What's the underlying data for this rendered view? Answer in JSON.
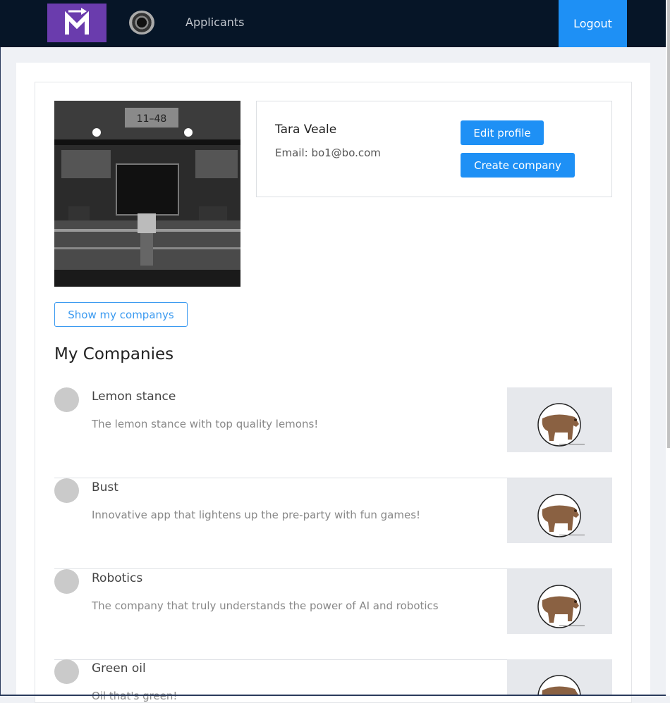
{
  "navbar": {
    "brand_letter": "M",
    "applicants_label": "Applicants",
    "logout_label": "Logout"
  },
  "profile": {
    "name": "Tara Veale",
    "email": "Email: bo1@bo.com",
    "photo_sign": "11–48",
    "edit_label": "Edit profile",
    "create_company_label": "Create company",
    "show_companies_label": "Show my companys"
  },
  "companies_section": {
    "title": "My Companies",
    "items": [
      {
        "name": "Lemon stance",
        "description": "The lemon stance with top quality lemons!"
      },
      {
        "name": "Bust",
        "description": "Innovative app that lightens up the pre-party with fun games!"
      },
      {
        "name": "Robotics",
        "description": "The company that truly understands the power of AI and robotics"
      },
      {
        "name": "Green oil",
        "description": "Oil that's green!"
      }
    ]
  },
  "colors": {
    "navbar_bg": "#061527",
    "brand_bg": "#6a3cad",
    "primary": "#1e90f5"
  },
  "icons": {
    "brand": "m-arrow-logo-icon",
    "company_avatar": "circle-avatar-icon",
    "company_logo": "bear-logo-icon"
  }
}
